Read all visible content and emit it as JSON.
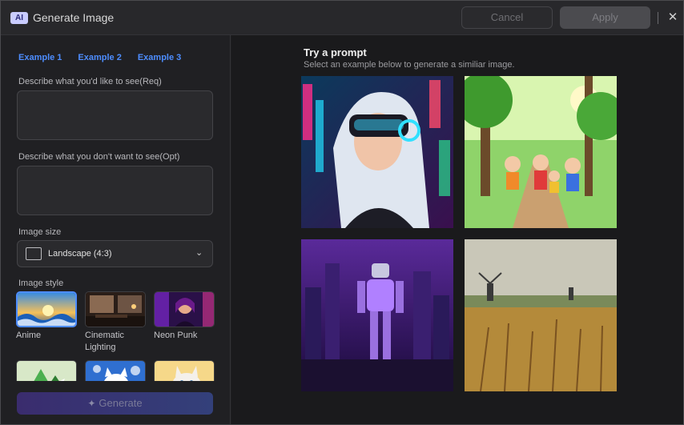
{
  "titlebar": {
    "badge": "AI",
    "title": "Generate Image",
    "cancel_label": "Cancel",
    "apply_label": "Apply",
    "close_glyph": "✕"
  },
  "left": {
    "tabs": [
      "Example 1",
      "Example 2",
      "Example 3"
    ],
    "positive_label": "Describe what you'd like to see(Req)",
    "positive_value": "",
    "negative_label": "Describe what you don't want to see(Opt)",
    "negative_value": "",
    "size_label": "Image size",
    "size_value": "Landscape (4:3)",
    "style_label": "Image style",
    "styles": [
      {
        "label": "Anime",
        "selected": true,
        "icon": "anime-thumbnail"
      },
      {
        "label": "Cinematic Lighting",
        "selected": false,
        "icon": "cinematic-thumbnail"
      },
      {
        "label": "Neon Punk",
        "selected": false,
        "icon": "neon-punk-thumbnail"
      },
      {
        "label": "",
        "selected": false,
        "icon": "origami-thumbnail"
      },
      {
        "label": "",
        "selected": false,
        "icon": "cat-cartoon-thumbnail"
      },
      {
        "label": "",
        "selected": false,
        "icon": "cat-watercolor-thumbnail"
      }
    ],
    "generate_label": "Generate"
  },
  "right": {
    "title": "Try a prompt",
    "subtitle": "Select an example below to generate a similiar image.",
    "examples": [
      {
        "icon": "cyberpunk-vr-girl-image"
      },
      {
        "icon": "anime-children-forest-image"
      },
      {
        "icon": "robot-neon-city-image"
      },
      {
        "icon": "windmill-wheat-field-image"
      }
    ]
  },
  "colors": {
    "accent": "#4d8dff",
    "background": "#1e1e20",
    "generate_gradient_start": "#3a2c6e",
    "generate_gradient_end": "#33407a"
  }
}
